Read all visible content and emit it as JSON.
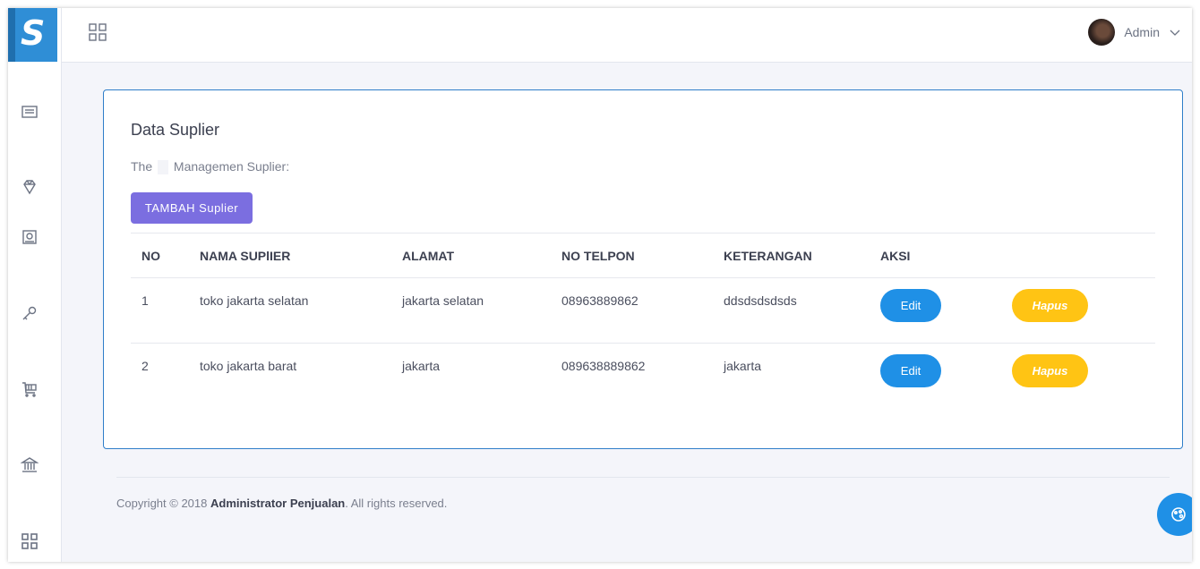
{
  "brand": {
    "logo_letter": "S",
    "color": "#2f8ed6"
  },
  "topbar": {
    "user_name": "Admin",
    "grid_icon": "grid-icon",
    "chevron_icon": "chevron-down-icon"
  },
  "sidebar": {
    "items": [
      {
        "icon": "list-icon"
      },
      {
        "icon": "diamond-icon"
      },
      {
        "icon": "image-icon"
      },
      {
        "icon": "key-icon"
      },
      {
        "icon": "cart-icon"
      },
      {
        "icon": "bank-icon"
      },
      {
        "icon": "grid-icon"
      }
    ]
  },
  "card": {
    "title": "Data Suplier",
    "subtitle_prefix": "The",
    "subtitle_rest": "Managemen Suplier:",
    "add_button": "TAMBAH Suplier"
  },
  "table": {
    "headers": [
      "NO",
      "NAMA SUPlIER",
      "ALAMAT",
      "NO TELPON",
      "KETERANGAN",
      "AKSI"
    ],
    "rows": [
      {
        "no": "1",
        "nama": "toko jakarta selatan",
        "alamat": "jakarta selatan",
        "telpon": "08963889862",
        "keterangan": "ddsdsdsdsds",
        "edit": "Edit",
        "hapus": "Hapus"
      },
      {
        "no": "2",
        "nama": "toko jakarta barat",
        "alamat": "jakarta",
        "telpon": "089638889862",
        "keterangan": "jakarta",
        "edit": "Edit",
        "hapus": "Hapus"
      }
    ]
  },
  "footer": {
    "prefix": "Copyright © 2018 ",
    "company": "Administrator Penjualan",
    "suffix": ". All rights reserved."
  },
  "colors": {
    "accent_purple": "#7b6ee0",
    "edit_blue": "#1f90e6",
    "hapus_yellow": "#ffc414",
    "card_border": "#2f7ec9"
  }
}
